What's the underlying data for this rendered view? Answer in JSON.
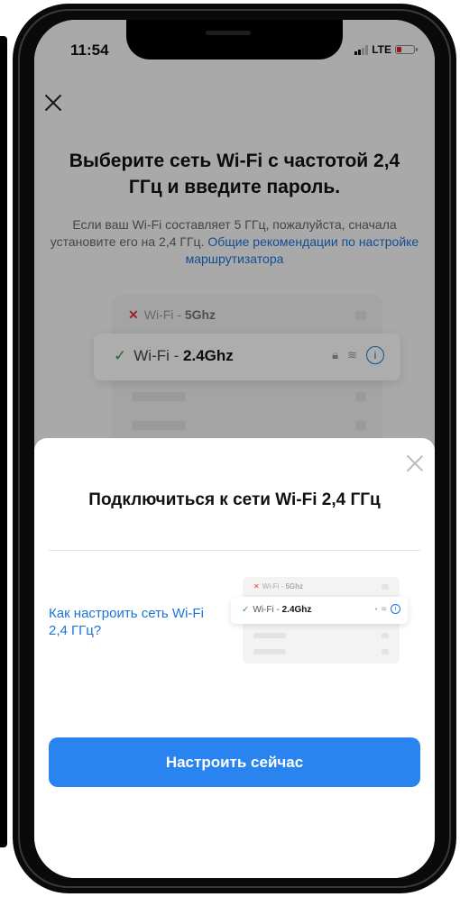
{
  "status_bar": {
    "time": "11:54",
    "network": "LTE"
  },
  "background": {
    "title": "Выберите сеть Wi-Fi с частотой 2,4 ГГц и введите пароль.",
    "description": "Если ваш Wi-Fi составляет 5 ГГц, пожалуйста, сначала установите его на 2,4 ГГц.",
    "description_link": "Общие рекомендации по настройке маршрутизатора",
    "wifi_bad": {
      "prefix": "Wi-Fi - ",
      "band": "5Ghz"
    },
    "wifi_good": {
      "prefix": "Wi-Fi - ",
      "band": "2.4Ghz"
    }
  },
  "sheet": {
    "title": "Подключиться к сети Wi-Fi 2,4 ГГц",
    "help_link": "Как настроить сеть Wi-Fi 2,4 ГГц?",
    "mini_bad": {
      "prefix": "Wi-Fi - ",
      "band": "5Ghz"
    },
    "mini_good": {
      "prefix": "Wi-Fi - ",
      "band": "2.4Ghz"
    },
    "cta_label": "Настроить сейчас"
  },
  "colors": {
    "accent": "#2a84f0",
    "link": "#1a73d9",
    "error": "#e53935",
    "ok": "#2e9d4a"
  }
}
